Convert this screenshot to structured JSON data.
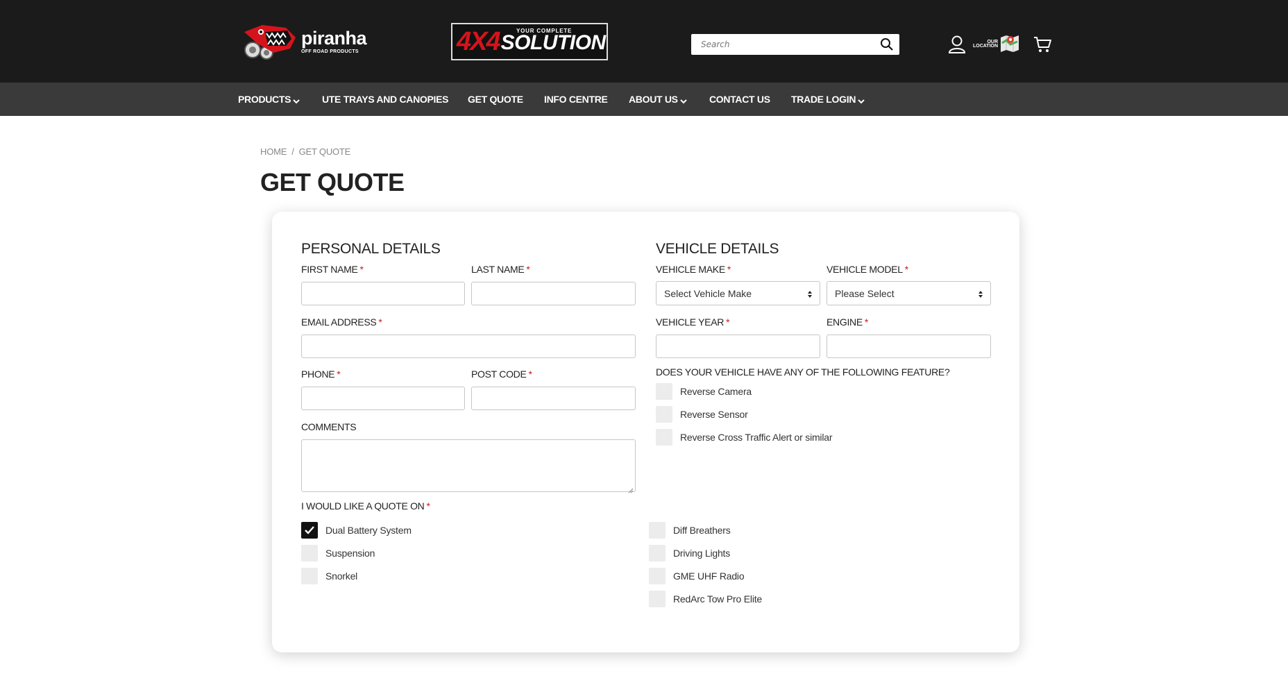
{
  "header": {
    "logo_brand": "piranha",
    "logo_brand_sub": "OFF ROAD PRODUCTS",
    "logo_solution_tag": "YOUR COMPLETE",
    "logo_solution_red": "4X4",
    "logo_solution_word": "SOLUTION",
    "search_placeholder": "Search",
    "location_label": "OUR LOCATION",
    "icons": [
      "search-icon",
      "user-icon",
      "location-map-icon",
      "cart-icon"
    ]
  },
  "nav": {
    "items": [
      {
        "label": "PRODUCTS",
        "dropdown": true
      },
      {
        "label": "UTE TRAYS AND CANOPIES",
        "dropdown": false
      },
      {
        "label": "GET QUOTE",
        "dropdown": false
      },
      {
        "label": "INFO CENTRE",
        "dropdown": false
      },
      {
        "label": "ABOUT US",
        "dropdown": true
      },
      {
        "label": "CONTACT US",
        "dropdown": false
      },
      {
        "label": "TRADE LOGIN",
        "dropdown": true
      }
    ]
  },
  "breadcrumb": {
    "home": "HOME",
    "separator": "/",
    "current": "GET QUOTE"
  },
  "page_title": "GET QUOTE",
  "form": {
    "required_mark": "*",
    "personal": {
      "title": "PERSONAL DETAILS",
      "first_name_label": "FIRST NAME",
      "first_name_value": "",
      "last_name_label": "LAST NAME",
      "last_name_value": "",
      "email_label": "EMAIL ADDRESS",
      "email_value": "",
      "phone_label": "PHONE",
      "phone_value": "",
      "postcode_label": "POST CODE",
      "postcode_value": "",
      "comments_label": "COMMENTS",
      "comments_value": ""
    },
    "vehicle": {
      "title": "VEHICLE DETAILS",
      "make_label": "VEHICLE MAKE",
      "make_selected": "Select Vehicle Make",
      "model_label": "VEHICLE MODEL",
      "model_selected": "Please Select",
      "year_label": "VEHICLE YEAR",
      "year_value": "",
      "engine_label": "ENGINE",
      "engine_value": "",
      "features_question": "DOES YOUR VEHICLE HAVE ANY OF THE FOLLOWING FEATURE?",
      "features": [
        {
          "label": "Reverse Camera",
          "checked": false
        },
        {
          "label": "Reverse Sensor",
          "checked": false
        },
        {
          "label": "Reverse Cross Traffic Alert or similar",
          "checked": false
        }
      ]
    },
    "quote": {
      "label": "I WOULD LIKE A QUOTE ON",
      "left_options": [
        {
          "label": "Dual Battery System",
          "checked": true
        },
        {
          "label": "Suspension",
          "checked": false
        },
        {
          "label": "Snorkel",
          "checked": false
        }
      ],
      "right_options": [
        {
          "label": "Diff Breathers",
          "checked": false
        },
        {
          "label": "Driving Lights",
          "checked": false
        },
        {
          "label": "GME UHF Radio",
          "checked": false
        },
        {
          "label": "RedArc Tow Pro Elite",
          "checked": false
        }
      ]
    }
  },
  "colors": {
    "header_bg": "#1b1b1b",
    "nav_bg": "#3a3a3a",
    "brand_red": "#d4141c",
    "checkbox_bg": "#ececec",
    "checkbox_checked": "#111111"
  }
}
